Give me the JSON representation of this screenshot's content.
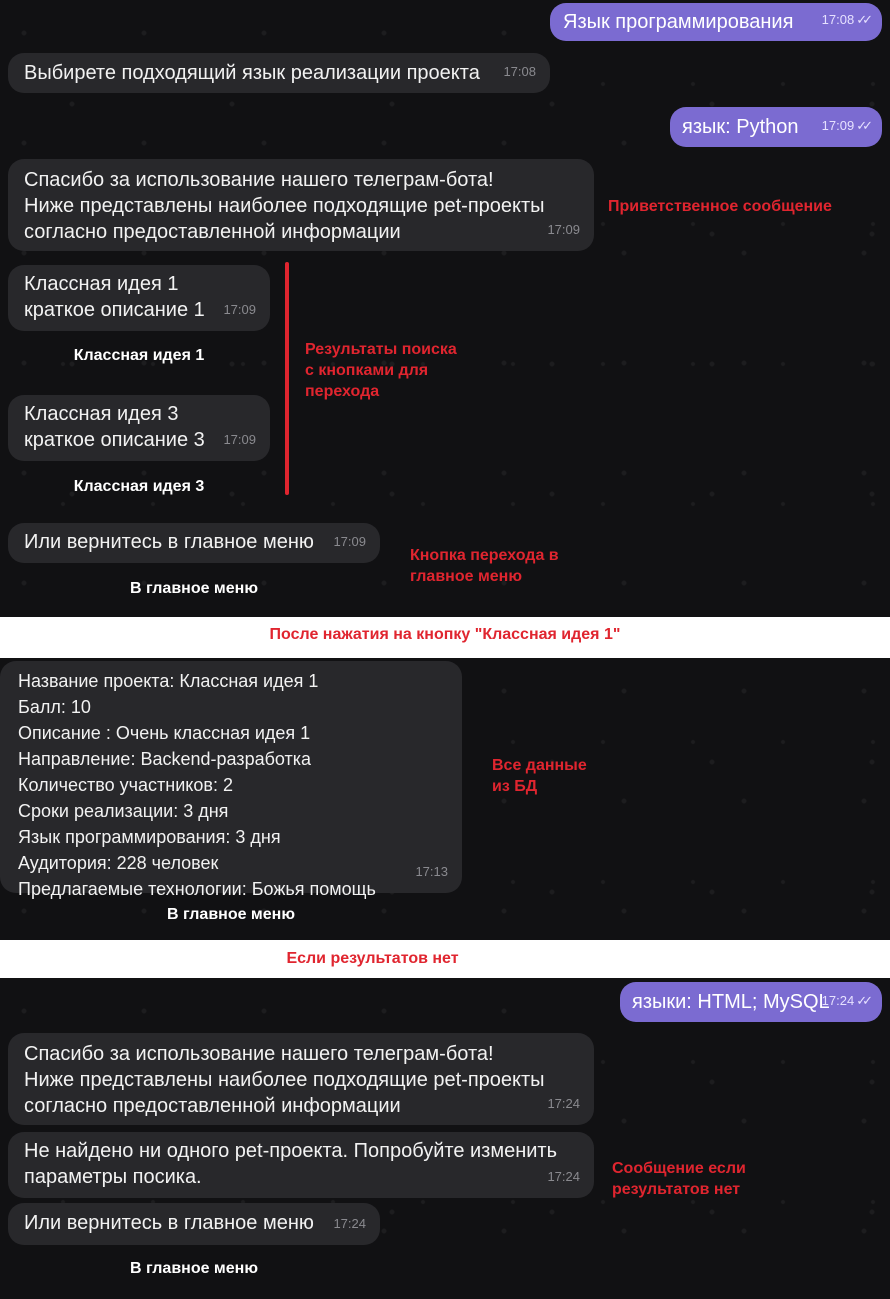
{
  "colors": {
    "incoming_bubble": "#28282b",
    "outgoing_bubble": "#7b6bd1",
    "background": "#111113",
    "annotation": "#e0252f"
  },
  "screen1": {
    "user_msg1": {
      "text": "Язык программирования",
      "time": "17:08"
    },
    "bot_msg1": {
      "text": "Выбирете подходящий язык реализации проекта",
      "time": "17:08"
    },
    "user_msg2": {
      "text": "язык: Python",
      "time": "17:09"
    },
    "bot_welcome": {
      "text": "Спасибо за использование нашего телеграм-бота!\nНиже представлены наиболее подходящие pet-проекты\nсогласно предоставленной информации",
      "time": "17:09"
    },
    "result1": {
      "text": "Классная идея 1\nкраткое описание 1",
      "time": "17:09",
      "button": "Классная идея 1"
    },
    "result2": {
      "text": "Классная идея 3\nкраткое описание 3",
      "time": "17:09",
      "button": "Классная идея 3"
    },
    "back_msg": {
      "text": "Или вернитесь в главное меню",
      "time": "17:09",
      "button": "В главное меню"
    },
    "note_welcome": "Приветственное сообщение",
    "note_results": "Результаты поиска\nс кнопками для\nперехода",
    "note_menu": "Кнопка перехода в\nглавное меню"
  },
  "caption1": "После нажатия на кнопку \"Классная идея 1\"",
  "screen2": {
    "details": {
      "text": "Название проекта: Классная идея 1\nБалл: 10\nОписание : Очень классная идея 1\nНаправление: Backend-разработка\nКоличество участников: 2\nСроки реализации: 3 дня\nЯзык программирования: 3 дня\nАудитория: 228 человек\nПредлагаемые технологии: Божья помощь",
      "time": "17:13",
      "button": "В главное меню"
    },
    "note": "Все данные\nиз БД"
  },
  "caption2": "Если результатов нет",
  "screen3": {
    "user_msg": {
      "text": "языки: HTML; MySQL",
      "time": "17:24"
    },
    "bot_welcome": {
      "text": "Спасибо за использование нашего телеграм-бота!\nНиже представлены наиболее подходящие pet-проекты\nсогласно предоставленной информации",
      "time": "17:24"
    },
    "not_found": {
      "text": "Не найдено ни одного pet-проекта. Попробуйте изменить\nпараметры посика.",
      "time": "17:24"
    },
    "back_msg": {
      "text": "Или вернитесь в главное меню",
      "time": "17:24",
      "button": "В главное меню"
    },
    "note": "Сообщение если\nрезультатов нет"
  }
}
